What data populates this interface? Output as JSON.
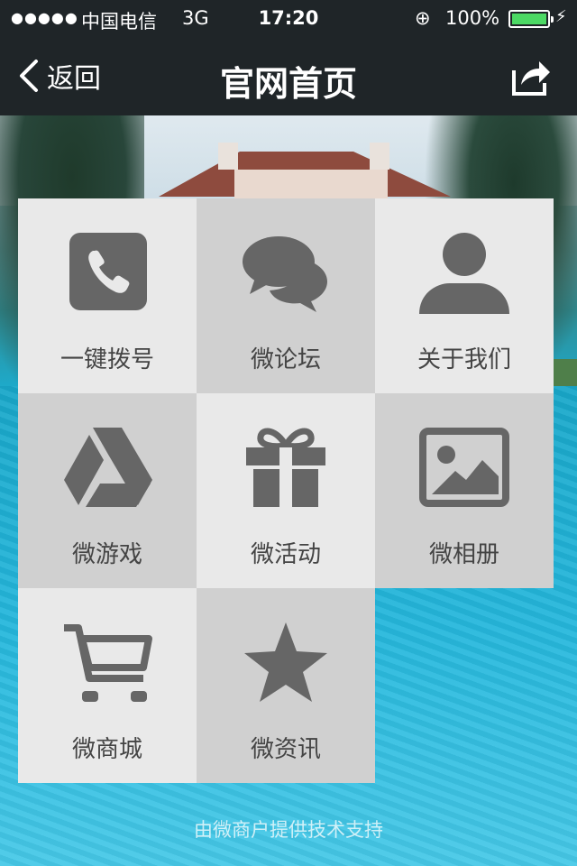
{
  "status_bar": {
    "signal": "●●●●●",
    "carrier": "中国电信",
    "network": "3G",
    "time": "17:20",
    "lock": "⊕",
    "battery": "100%",
    "battery_level": 1.0,
    "charge": "⚡"
  },
  "nav": {
    "back_label": "返回",
    "title": "官网首页"
  },
  "tiles": [
    {
      "label": "一键拨号",
      "icon": "phone-icon",
      "shade": "light"
    },
    {
      "label": "微论坛",
      "icon": "chat-bubbles-icon",
      "shade": "dark"
    },
    {
      "label": "关于我们",
      "icon": "person-icon",
      "shade": "light"
    },
    {
      "label": "微游戏",
      "icon": "drive-triangle-icon",
      "shade": "dark"
    },
    {
      "label": "微活动",
      "icon": "gift-icon",
      "shade": "light"
    },
    {
      "label": "微相册",
      "icon": "image-icon",
      "shade": "dark"
    },
    {
      "label": "微商城",
      "icon": "cart-icon",
      "shade": "light"
    },
    {
      "label": "微资讯",
      "icon": "star-icon",
      "shade": "dark"
    }
  ],
  "footer": "由微商户提供技术支持",
  "colors": {
    "bar": "#1f2528",
    "tile_light": "#e9e9e9",
    "tile_dark": "#d0d0d0",
    "icon": "#666666",
    "battery": "#4cd964"
  }
}
